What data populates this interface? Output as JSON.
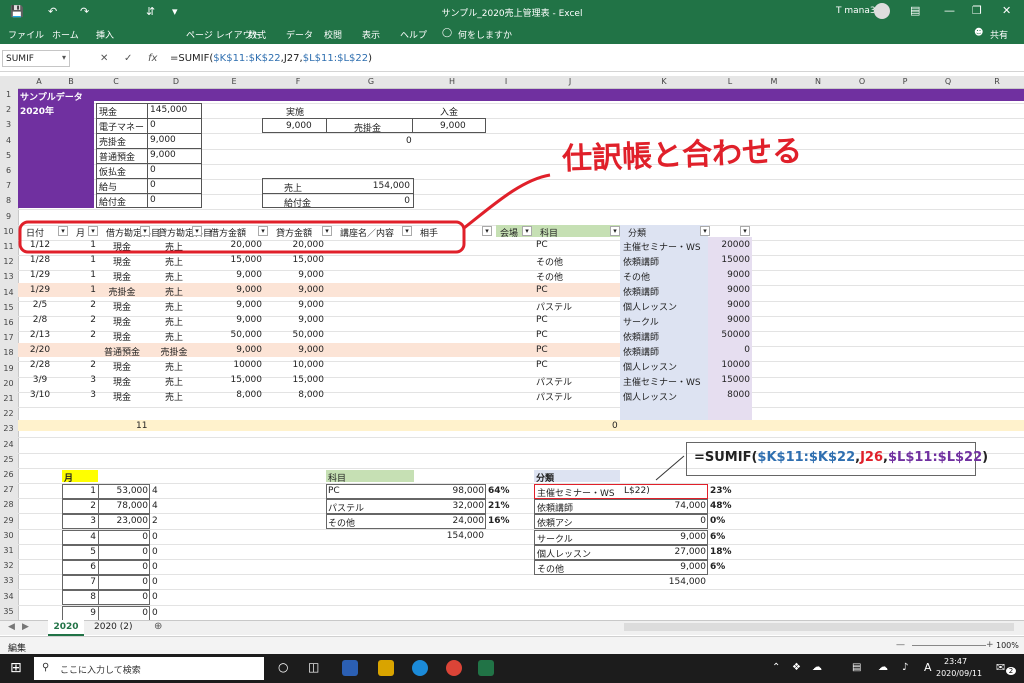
{
  "window": {
    "title": "サンプル_2020売上管理表 - Excel",
    "user": "T mana3"
  },
  "ribbon": {
    "tabs": [
      "ファイル",
      "ホーム",
      "挿入",
      "ページ レイアウト",
      "数式",
      "データ",
      "校閲",
      "表示",
      "ヘルプ"
    ],
    "tell_me": "何をしますか",
    "share": "共有"
  },
  "formula_bar": {
    "name_box": "SUMIF",
    "fx": "fx",
    "formula_prefix": "=SUMIF(",
    "formula_ref1": "$K$11:$K$22",
    "formula_mid": ",J27,",
    "formula_ref2": "$L$11:$L$22",
    "formula_suffix": ")"
  },
  "columns": [
    "A",
    "B",
    "C",
    "D",
    "E",
    "F",
    "G",
    "H",
    "I",
    "J",
    "K",
    "L",
    "M",
    "N",
    "O",
    "P",
    "Q",
    "R"
  ],
  "rows": [
    "1",
    "2",
    "3",
    "4",
    "5",
    "6",
    "7",
    "8",
    "9",
    "10",
    "11",
    "12",
    "13",
    "14",
    "15",
    "16",
    "17",
    "18",
    "19",
    "20",
    "21",
    "22",
    "23",
    "24",
    "25",
    "26",
    "27",
    "28",
    "29",
    "30",
    "31",
    "32",
    "33",
    "34",
    "35"
  ],
  "banner": {
    "title": "サンプルデータ",
    "year": "2020年"
  },
  "balance": [
    {
      "label": "現金",
      "value": "145,000"
    },
    {
      "label": "電子マネー",
      "value": "0"
    },
    {
      "label": "売掛金",
      "value": "9,000"
    },
    {
      "label": "普通預金",
      "value": "9,000"
    },
    {
      "label": "仮払金",
      "value": "0"
    },
    {
      "label": "給与",
      "value": "0"
    },
    {
      "label": "給付金",
      "value": "0"
    }
  ],
  "jisshi": {
    "label": "実施",
    "amount": "9,000",
    "urikake": "売掛金",
    "value": "9,000",
    "zero": "0"
  },
  "nyukin": {
    "label": "入金"
  },
  "uriage": {
    "label": "売上",
    "value": "154,000"
  },
  "kyufukin": {
    "label": "給付金",
    "value": "0"
  },
  "annotation": {
    "handwritten": "仕訳帳と合わせる",
    "formula": "=SUMIF(",
    "f_ref1": "$K$11:$K$22",
    "f_sep1": ",",
    "f_ref2": "J26",
    "f_sep2": ",",
    "f_ref3": "$L$11:$L$22",
    "f_end": ")"
  },
  "table_headers": [
    "日付",
    "月",
    "借方勘定科目",
    "貸方勘定科目",
    "借方金額",
    "貸方金額",
    "講座名／内容",
    "相手",
    "会場",
    "科目",
    "分類",
    ""
  ],
  "table_rows": [
    {
      "date": "1/12",
      "month": "1",
      "debit": "現金",
      "credit": "売上",
      "dr": "20,000",
      "cr": "20,000",
      "subject": "PC",
      "category": "主催セミナー・WS",
      "amount": "20000",
      "highlight": false
    },
    {
      "date": "1/28",
      "month": "1",
      "debit": "現金",
      "credit": "売上",
      "dr": "15,000",
      "cr": "15,000",
      "subject": "その他",
      "category": "依頼講師",
      "amount": "15000",
      "highlight": false
    },
    {
      "date": "1/29",
      "month": "1",
      "debit": "現金",
      "credit": "売上",
      "dr": "9,000",
      "cr": "9,000",
      "subject": "その他",
      "category": "その他",
      "amount": "9000",
      "highlight": false
    },
    {
      "date": "1/29",
      "month": "1",
      "debit": "売掛金",
      "credit": "売上",
      "dr": "9,000",
      "cr": "9,000",
      "subject": "PC",
      "category": "依頼講師",
      "amount": "9000",
      "highlight": true
    },
    {
      "date": "2/5",
      "month": "2",
      "debit": "現金",
      "credit": "売上",
      "dr": "9,000",
      "cr": "9,000",
      "subject": "パステル",
      "category": "個人レッスン",
      "amount": "9000",
      "highlight": false
    },
    {
      "date": "2/8",
      "month": "2",
      "debit": "現金",
      "credit": "売上",
      "dr": "9,000",
      "cr": "9,000",
      "subject": "PC",
      "category": "サークル",
      "amount": "9000",
      "highlight": false
    },
    {
      "date": "2/13",
      "month": "2",
      "debit": "現金",
      "credit": "売上",
      "dr": "50,000",
      "cr": "50,000",
      "subject": "PC",
      "category": "依頼講師",
      "amount": "50000",
      "highlight": false
    },
    {
      "date": "2/20",
      "month": "",
      "debit": "普通預金",
      "credit": "売掛金",
      "dr": "9,000",
      "cr": "9,000",
      "subject": "PC",
      "category": "依頼講師",
      "amount": "0",
      "highlight": true
    },
    {
      "date": "2/28",
      "month": "2",
      "debit": "現金",
      "credit": "売上",
      "dr": "10000",
      "cr": "10,000",
      "subject": "PC",
      "category": "個人レッスン",
      "amount": "10000",
      "highlight": false
    },
    {
      "date": "3/9",
      "month": "3",
      "debit": "現金",
      "credit": "売上",
      "dr": "15,000",
      "cr": "15,000",
      "subject": "パステル",
      "category": "主催セミナー・WS",
      "amount": "15000",
      "highlight": false
    },
    {
      "date": "3/10",
      "month": "3",
      "debit": "現金",
      "credit": "売上",
      "dr": "8,000",
      "cr": "8,000",
      "subject": "パステル",
      "category": "個人レッスン",
      "amount": "8000",
      "highlight": false
    }
  ],
  "row23": {
    "count": "11",
    "zero": "0"
  },
  "month_table": {
    "header": "月",
    "rows": [
      {
        "m": "1",
        "v": "53,000",
        "c": "4"
      },
      {
        "m": "2",
        "v": "78,000",
        "c": "4"
      },
      {
        "m": "3",
        "v": "23,000",
        "c": "2"
      },
      {
        "m": "4",
        "v": "0",
        "c": "0"
      },
      {
        "m": "5",
        "v": "0",
        "c": "0"
      },
      {
        "m": "6",
        "v": "0",
        "c": "0"
      },
      {
        "m": "7",
        "v": "0",
        "c": "0"
      },
      {
        "m": "8",
        "v": "0",
        "c": "0"
      },
      {
        "m": "9",
        "v": "0",
        "c": "0"
      }
    ]
  },
  "subject_table": {
    "header": "科目",
    "rows": [
      {
        "n": "PC",
        "v": "98,000",
        "p": "64%"
      },
      {
        "n": "パステル",
        "v": "32,000",
        "p": "21%"
      },
      {
        "n": "その他",
        "v": "24,000",
        "p": "16%"
      }
    ],
    "total": "154,000"
  },
  "category_table": {
    "header": "分類",
    "rows": [
      {
        "n": "主催セミナー・WS",
        "v": "L$22)",
        "p": "23%"
      },
      {
        "n": "依頼講師",
        "v": "74,000",
        "p": "48%"
      },
      {
        "n": "依頼アシ",
        "v": "0",
        "p": "0%"
      },
      {
        "n": "サークル",
        "v": "9,000",
        "p": "6%"
      },
      {
        "n": "個人レッスン",
        "v": "27,000",
        "p": "18%"
      },
      {
        "n": "その他",
        "v": "9,000",
        "p": "6%"
      }
    ],
    "total": "154,000"
  },
  "sheet_tabs": [
    "2020",
    "2020 (2)"
  ],
  "status": {
    "mode": "編集",
    "zoom": "100%"
  },
  "taskbar": {
    "search": "ここに入力して検索",
    "time": "23:47",
    "date": "2020/09/11",
    "ime": "A",
    "badge": "2"
  },
  "colors": {
    "excel_green": "#217346",
    "purple": "#7030a0",
    "pink": "#fce4d6",
    "yellow_row": "#fff2cc",
    "blue_col": "#dde3f2",
    "purple_col": "#e6def0",
    "green_hdr": "#c6e0b4",
    "annotation_red": "#e0202a"
  }
}
